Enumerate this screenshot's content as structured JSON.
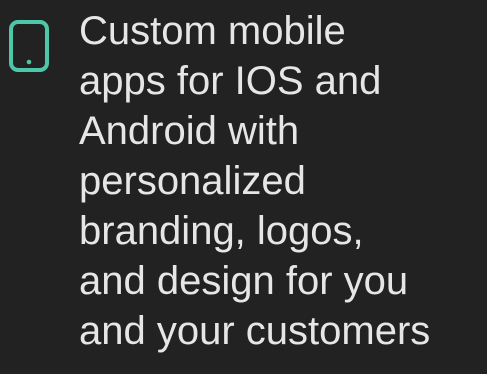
{
  "feature": {
    "icon": "smartphone-icon",
    "text": "Custom mobile\napps for IOS and\nAndroid with\npersonalized\nbranding, logos,\nand design for you\nand your customers"
  },
  "colors": {
    "background": "#222222",
    "text": "#e6e6e6",
    "icon": "#4cc7a7"
  }
}
